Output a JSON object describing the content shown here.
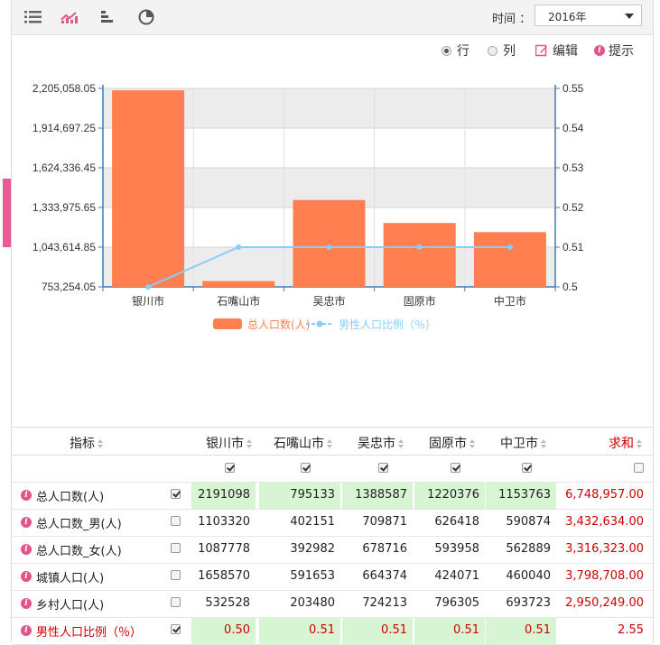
{
  "toolbar": {
    "time_label": "时间 ：",
    "time_value": "2016年",
    "icons": [
      "list-icon",
      "line-chart-icon",
      "bar-chart-icon",
      "pie-chart-icon"
    ]
  },
  "options": {
    "row_label": "行",
    "col_label": "列",
    "edit_label": "编辑",
    "tip_label": "提示",
    "row_selected": true
  },
  "colors": {
    "bar": "#ff7f50",
    "line": "#87cefa",
    "accent": "#e4548a",
    "sum": "#cc0000",
    "highlight": "#d8f5d3"
  },
  "chart_data": {
    "type": "bar",
    "categories": [
      "银川市",
      "石嘴山市",
      "吴忠市",
      "固原市",
      "中卫市"
    ],
    "series": [
      {
        "name": "总人口数(人)",
        "type": "bar",
        "axis": "left",
        "values": [
          2191098,
          795133,
          1388587,
          1220376,
          1153763
        ]
      },
      {
        "name": "男性人口比例（％）",
        "type": "line",
        "axis": "right",
        "values": [
          0.5,
          0.51,
          0.51,
          0.51,
          0.51
        ]
      }
    ],
    "y_left": {
      "min": 753254.05,
      "max": 2205058.05,
      "ticks": [
        "753,254.05",
        "1,043,614.85",
        "1,333,975.65",
        "1,624,336.45",
        "1,914,697.25",
        "2,205,058.05"
      ]
    },
    "y_right": {
      "min": 0.5,
      "max": 0.55,
      "ticks": [
        "0.5",
        "0.51",
        "0.52",
        "0.53",
        "0.54",
        "0.55"
      ]
    },
    "legend_position": "bottom",
    "grid": true
  },
  "table": {
    "headers": [
      "指标",
      "银川市",
      "石嘴山市",
      "吴忠市",
      "固原市",
      "中卫市",
      "求和"
    ],
    "header_checks": [
      true,
      true,
      true,
      true,
      true,
      false
    ],
    "rows": [
      {
        "label": "总人口数(人)",
        "checked": true,
        "values": [
          "2191098",
          "795133",
          "1388587",
          "1220376",
          "1153763"
        ],
        "sum": "6,748,957.00",
        "highlight": true,
        "red": false
      },
      {
        "label": "总人口数_男(人)",
        "checked": false,
        "values": [
          "1103320",
          "402151",
          "709871",
          "626418",
          "590874"
        ],
        "sum": "3,432,634.00",
        "highlight": false,
        "red": false
      },
      {
        "label": "总人口数_女(人)",
        "checked": false,
        "values": [
          "1087778",
          "392982",
          "678716",
          "593958",
          "562889"
        ],
        "sum": "3,316,323.00",
        "highlight": false,
        "red": false
      },
      {
        "label": "城镇人口(人)",
        "checked": false,
        "values": [
          "1658570",
          "591653",
          "664374",
          "424071",
          "460040"
        ],
        "sum": "3,798,708.00",
        "highlight": false,
        "red": false
      },
      {
        "label": "乡村人口(人)",
        "checked": false,
        "values": [
          "532528",
          "203480",
          "724213",
          "796305",
          "693723"
        ],
        "sum": "2,950,249.00",
        "highlight": false,
        "red": false
      },
      {
        "label": "男性人口比例（％）",
        "checked": true,
        "values": [
          "0.50",
          "0.51",
          "0.51",
          "0.51",
          "0.51"
        ],
        "sum": "2.55",
        "highlight": true,
        "red": true
      }
    ]
  }
}
